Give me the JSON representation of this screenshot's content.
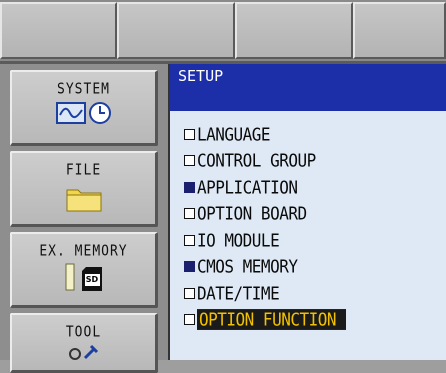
{
  "side_menu": {
    "items": [
      {
        "label": "SYSTEM",
        "icons": [
          "waveform-monitor-icon",
          "clock-icon"
        ]
      },
      {
        "label": "FILE",
        "icons": [
          "folder-icon"
        ]
      },
      {
        "label": "EX. MEMORY",
        "icons": [
          "usb-stick-icon",
          "sd-card-icon"
        ],
        "sd_text": "SD"
      },
      {
        "label": "TOOL",
        "icons": [
          "wrench-icon"
        ]
      }
    ]
  },
  "panel": {
    "title": "SETUP",
    "items": [
      {
        "label": "LANGUAGE",
        "checked": false,
        "selected": false
      },
      {
        "label": "CONTROL GROUP",
        "checked": false,
        "selected": false
      },
      {
        "label": "APPLICATION",
        "checked": true,
        "selected": false
      },
      {
        "label": "OPTION BOARD",
        "checked": false,
        "selected": false
      },
      {
        "label": "IO MODULE",
        "checked": false,
        "selected": false
      },
      {
        "label": "CMOS MEMORY",
        "checked": true,
        "selected": false
      },
      {
        "label": "DATE/TIME",
        "checked": false,
        "selected": false
      },
      {
        "label": "OPTION FUNCTION",
        "checked": false,
        "selected": true
      }
    ]
  },
  "colors": {
    "title_bar": "#1d2fa8",
    "panel_bg": "#dfe9f5",
    "highlight_bg": "#1a1a1a",
    "highlight_text": "#f2c200"
  }
}
